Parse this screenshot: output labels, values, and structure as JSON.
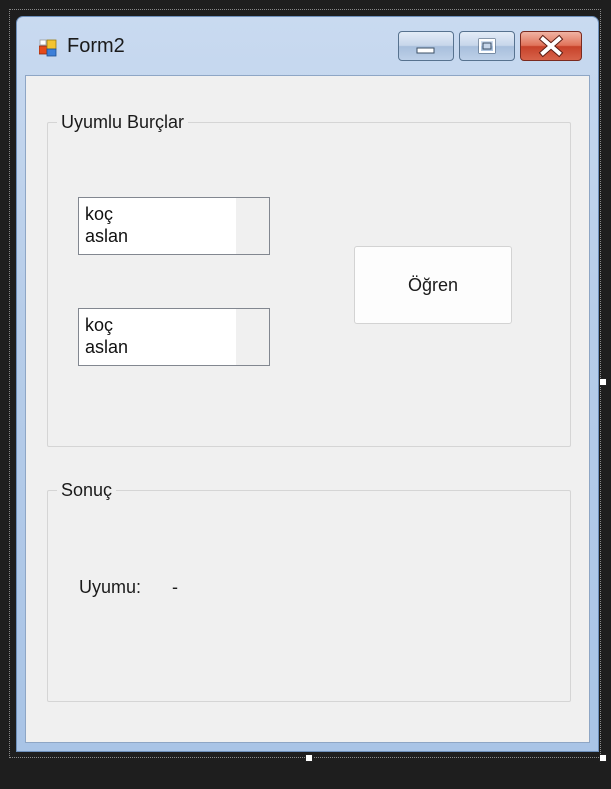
{
  "window": {
    "title": "Form2"
  },
  "groups": {
    "compatible_signs": {
      "label": "Uyumlu Burçlar",
      "listbox1": {
        "items": [
          "koç",
          "aslan"
        ]
      },
      "listbox2": {
        "items": [
          "koç",
          "aslan"
        ]
      },
      "learn_button_label": "Öğren"
    },
    "result": {
      "label": "Sonuç",
      "compat_label": "Uyumu:",
      "compat_value": "-"
    }
  },
  "colors": {
    "client_background": "#f0f0f0",
    "close_button": "#c7422a",
    "titlebar": "#b7cde9"
  },
  "icons": {
    "app": "form-app-icon",
    "minimize": "minimize-icon",
    "maximize": "maximize-icon",
    "close": "close-icon"
  }
}
